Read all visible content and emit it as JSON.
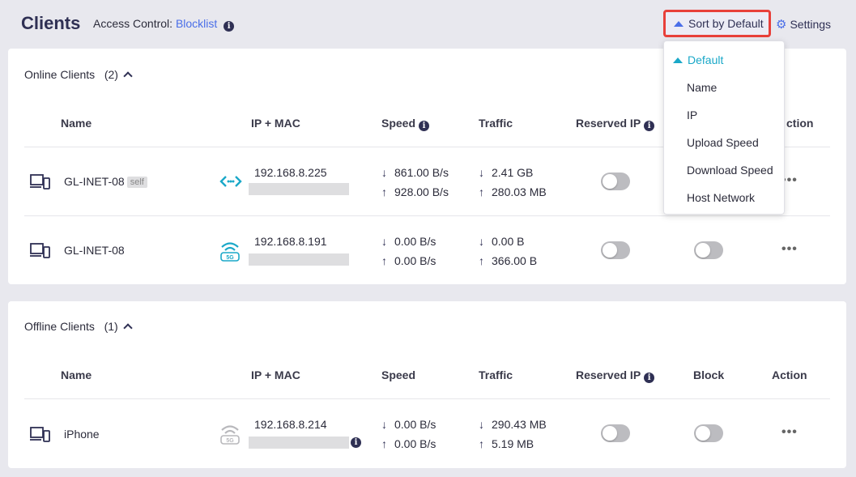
{
  "header": {
    "title": "Clients",
    "access_label": "Access Control:",
    "access_value": "Blocklist",
    "sort_label": "Sort by Default",
    "settings_label": "Settings"
  },
  "columns": {
    "name": "Name",
    "ip_mac": "IP + MAC",
    "speed": "Speed",
    "traffic": "Traffic",
    "reserved_ip": "Reserved IP",
    "block": "Block",
    "action": "Action",
    "action_partial": "ction"
  },
  "online": {
    "title": "Online Clients",
    "count": "(2)",
    "rows": [
      {
        "name": "GL-INET-08",
        "badge": "self",
        "connection": "lan-icon",
        "ip": "192.168.8.225",
        "down_speed": "861.00 B/s",
        "up_speed": "928.00 B/s",
        "down_traffic": "2.41 GB",
        "up_traffic": "280.03 MB"
      },
      {
        "name": "GL-INET-08",
        "badge": "",
        "connection": "wifi-5g-icon",
        "ip": "192.168.8.191",
        "down_speed": "0.00 B/s",
        "up_speed": "0.00 B/s",
        "down_traffic": "0.00 B",
        "up_traffic": "366.00 B"
      }
    ]
  },
  "offline": {
    "title": "Offline Clients",
    "count": "(1)",
    "rows": [
      {
        "name": "iPhone",
        "connection": "wifi-5g-icon",
        "ip": "192.168.8.214",
        "down_speed": "0.00 B/s",
        "up_speed": "0.00 B/s",
        "down_traffic": "290.43 MB",
        "up_traffic": "5.19 MB"
      }
    ]
  },
  "sort_menu": {
    "items": [
      "Default",
      "Name",
      "IP",
      "Upload Speed",
      "Download Speed",
      "Host Network"
    ],
    "active": "Default"
  },
  "icons": {
    "wifi_band": "5G",
    "info": "i",
    "more": "•••"
  },
  "colors": {
    "accent": "#4a6ee8",
    "teal": "#1aa8c8",
    "highlight_border": "#e8403a"
  }
}
